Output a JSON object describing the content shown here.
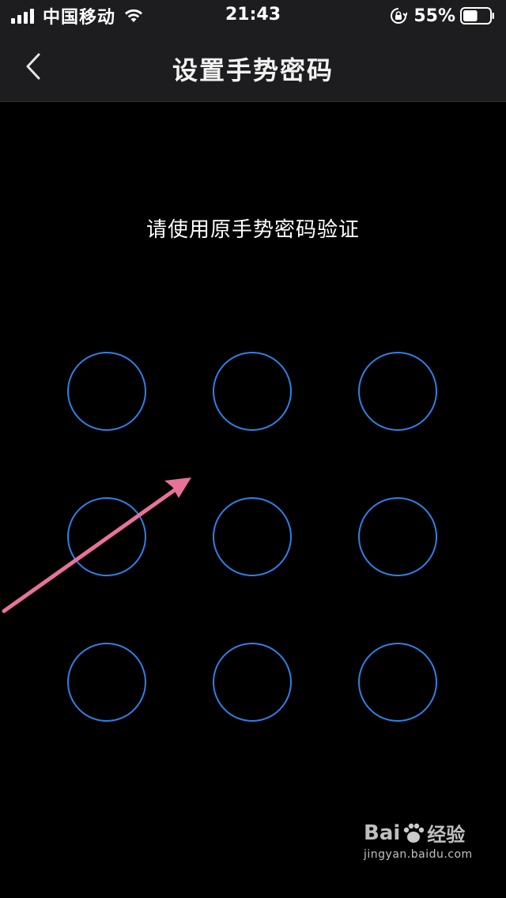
{
  "status_bar": {
    "carrier": "中国移动",
    "time": "21:43",
    "battery_percent": "55%",
    "battery_level": 0.55,
    "icons": [
      "signal-icon",
      "wifi-icon",
      "rotation-lock-icon",
      "battery-icon"
    ]
  },
  "nav": {
    "title": "设置手势密码",
    "back_icon": "chevron-left-icon"
  },
  "main": {
    "prompt": "请使用原手势密码验证",
    "pattern_dot_count": 9
  },
  "colors": {
    "background": "#000000",
    "nav_background": "#1d1d1f",
    "dot_border": "#2f80e6",
    "annotation_arrow": "#e8729a"
  },
  "watermark": {
    "brand_left": "Bai",
    "brand_right": "经验",
    "url": "jingyan.baidu.com"
  }
}
